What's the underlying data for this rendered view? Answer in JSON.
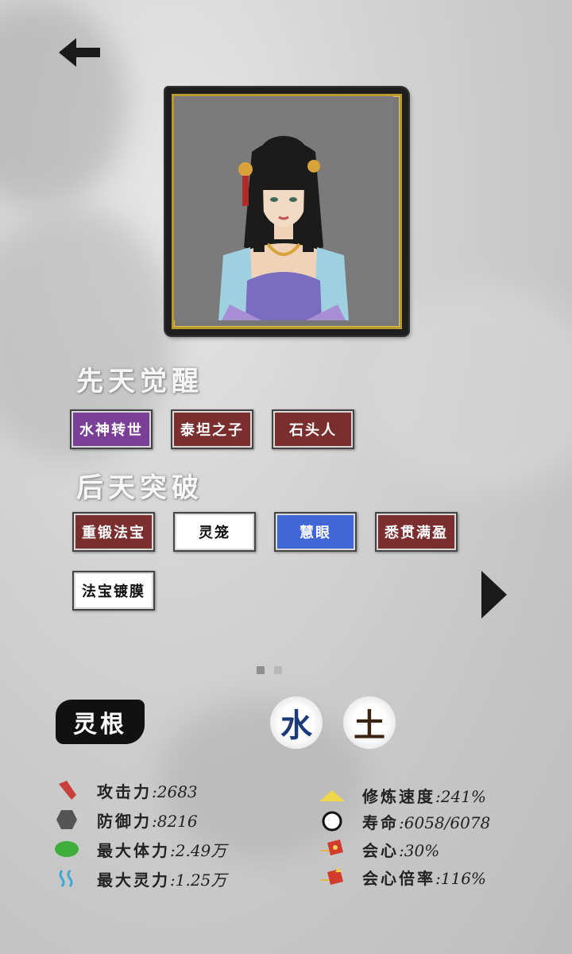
{
  "innate": {
    "title": "先天觉醒",
    "tags": [
      {
        "label": "水神转世",
        "color": "#7a3f97"
      },
      {
        "label": "泰坦之子",
        "color": "#7a2e2e"
      },
      {
        "label": "石头人",
        "color": "#7a2e2e"
      }
    ]
  },
  "acquired": {
    "title": "后天突破",
    "tags": [
      {
        "label": "重锻法宝",
        "color": "#7a2e2e"
      },
      {
        "label": "灵笼",
        "color": "#ffffff"
      },
      {
        "label": "慧眼",
        "color": "#3f68d6"
      },
      {
        "label": "悉贯满盈",
        "color": "#7a2e2e"
      },
      {
        "label": "法宝镀膜",
        "color": "#ffffff"
      }
    ]
  },
  "pager": {
    "current_page": 1,
    "total_pages": 2
  },
  "spirit_root": {
    "label": "灵根",
    "elements": [
      {
        "char": "水",
        "color": "#1d3a78"
      },
      {
        "char": "土",
        "color": "#3b2410"
      }
    ]
  },
  "stats": {
    "left": [
      {
        "label": "攻击力",
        "value": ":2683",
        "icon": "attack-icon"
      },
      {
        "label": "防御力",
        "value": ":8216",
        "icon": "defense-icon"
      },
      {
        "label": "最大体力",
        "value": ":2.49万",
        "icon": "stamina-icon"
      },
      {
        "label": "最大灵力",
        "value": ":1.25万",
        "icon": "spirit-power-icon"
      }
    ],
    "right": [
      {
        "label": "修炼速度",
        "value": ":241%",
        "icon": "cultivation-speed-icon"
      },
      {
        "label": "寿命",
        "value": ":6058/6078",
        "icon": "lifespan-icon"
      },
      {
        "label": "会心",
        "value": ":30%",
        "icon": "crit-icon"
      },
      {
        "label": "会心倍率",
        "value": ":116%",
        "icon": "crit-multiplier-icon"
      }
    ]
  }
}
